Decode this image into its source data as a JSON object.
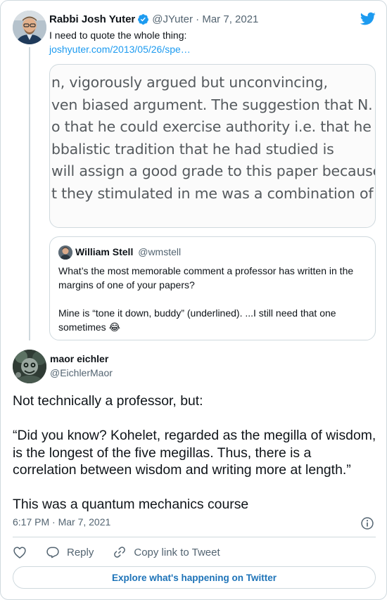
{
  "parent_tweet": {
    "name": "Rabbi Josh Yuter",
    "handle_date": "@JYuter · Mar 7, 2021",
    "text": "I need to quote the whole thing:",
    "link": "joshyuter.com/2013/05/26/spe…",
    "media_lines": [
      "n, vigorously argued but unconvincing,",
      "ven biased argument. The suggestion that N.",
      "o that he could exercise authority i.e. that he",
      "bbalistic tradition that he had studied is",
      " will assign a good grade to this paper because",
      "t they stimulated in me was a combination of"
    ]
  },
  "quoted_tweet": {
    "name": "William Stell",
    "handle": "@wmstell",
    "para1": "What’s the most memorable comment a professor has written in the margins of one of your papers?",
    "para2": "Mine is “tone it down, buddy” (underlined). ...I still need that one sometimes 😂"
  },
  "main_tweet": {
    "name": "maor eichler",
    "handle": "@EichlerMaor",
    "para1": "Not technically a professor, but:",
    "para2": "“Did you know? Kohelet, regarded as the megilla of wisdom, is the longest of the five megillas. Thus, there is a correlation between wisdom and writing more at length.”",
    "para3": "This was a quantum mechanics course",
    "timestamp": "6:17 PM · Mar 7, 2021"
  },
  "actions": {
    "like_icon": "heart-icon",
    "reply_label": "Reply",
    "copy_label": "Copy link to Tweet"
  },
  "explore_label": "Explore what's happening on Twitter",
  "colors": {
    "accent": "#1d9bf0",
    "secondary_text": "#536471",
    "border": "#cfd9de"
  }
}
